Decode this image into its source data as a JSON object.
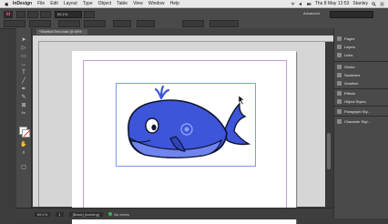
{
  "menubar": {
    "app_name": "InDesign",
    "items": [
      "File",
      "Edit",
      "Layout",
      "Type",
      "Object",
      "Table",
      "View",
      "Window",
      "Help"
    ],
    "clock": "Thu 8 May  12:53",
    "user": "Stanley"
  },
  "control": {
    "zoom": "69.1%",
    "workspace": "Advanced"
  },
  "document": {
    "tab_label": "*Starfish/Test.indd @ 69%"
  },
  "statusbar": {
    "zoom": "69.1%",
    "page": "1",
    "mode": "[Basic] (working)",
    "errors": "No errors"
  },
  "panels": [
    {
      "label": "Pages",
      "icon": "pages-icon"
    },
    {
      "label": "Layers",
      "icon": "layers-icon"
    },
    {
      "label": "Links",
      "icon": "links-icon"
    },
    {
      "label": "Stroke",
      "icon": "stroke-icon"
    },
    {
      "label": "Swatches",
      "icon": "swatches-icon"
    },
    {
      "label": "Gradient",
      "icon": "gradient-icon"
    },
    {
      "label": "Effects",
      "icon": "effects-icon"
    },
    {
      "label": "Object Styles",
      "icon": "object-styles-icon"
    },
    {
      "label": "Paragraph Sty...",
      "icon": "paragraph-styles-icon"
    },
    {
      "label": "Character Styl...",
      "icon": "character-styles-icon"
    }
  ],
  "colors": {
    "whale_body": "#3d55d8",
    "whale_belly": "#6f84ee",
    "whale_outline": "#0e1430",
    "margin_guide": "#c49ad8",
    "frame_edge": "#7a9be8"
  }
}
